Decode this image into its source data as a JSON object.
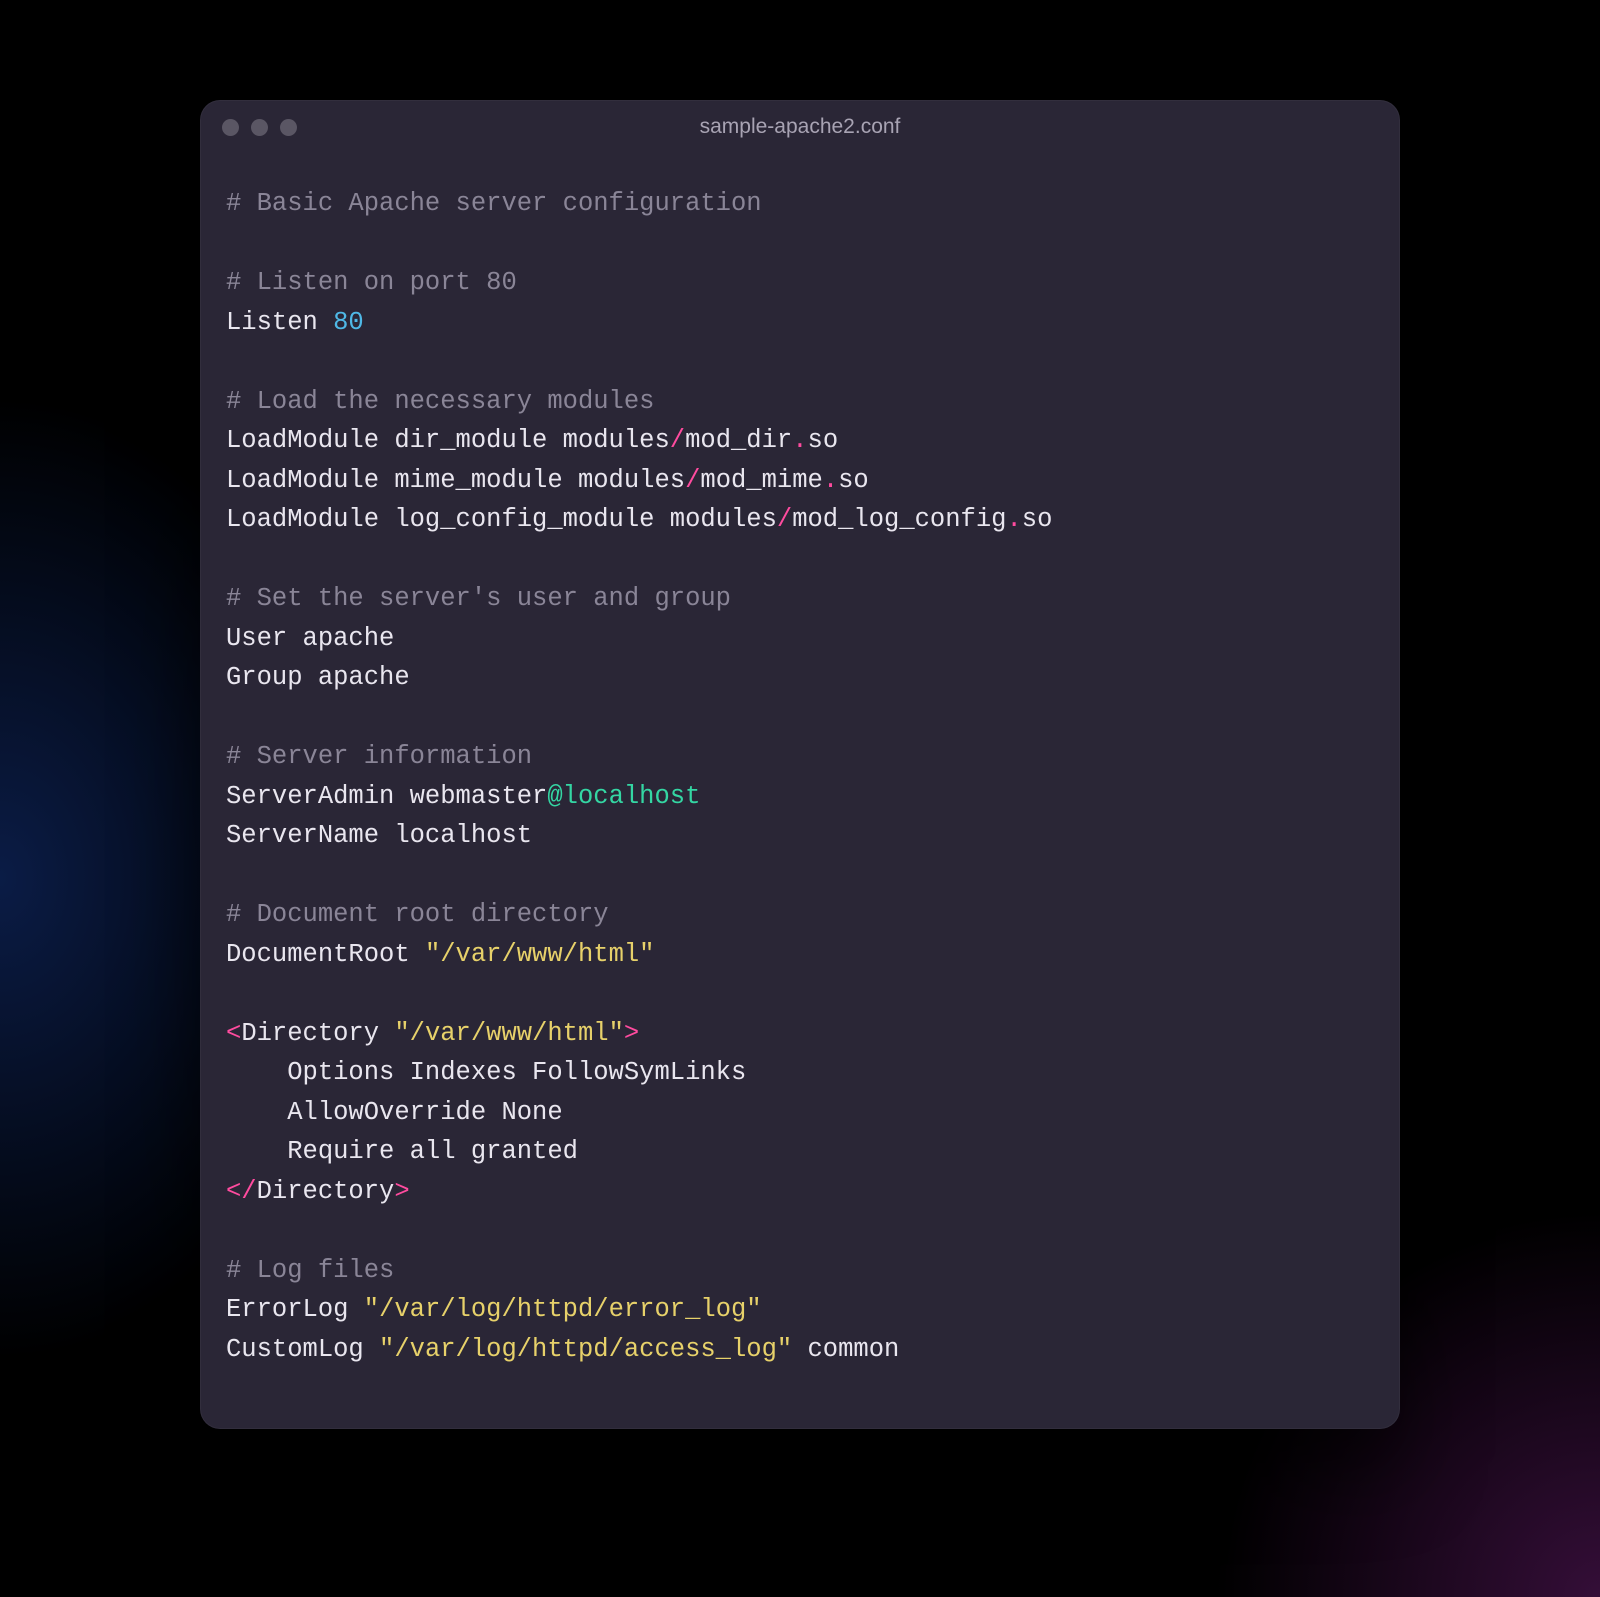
{
  "window": {
    "title": "sample-apache2.conf"
  },
  "code": {
    "lines": [
      [
        {
          "cls": "tok-comment",
          "t": "# Basic Apache server configuration"
        }
      ],
      [
        {
          "cls": "tok-plain",
          "t": ""
        }
      ],
      [
        {
          "cls": "tok-comment",
          "t": "# Listen on port 80"
        }
      ],
      [
        {
          "cls": "tok-plain",
          "t": "Listen "
        },
        {
          "cls": "tok-num",
          "t": "80"
        }
      ],
      [
        {
          "cls": "tok-plain",
          "t": ""
        }
      ],
      [
        {
          "cls": "tok-comment",
          "t": "# Load the necessary modules"
        }
      ],
      [
        {
          "cls": "tok-plain",
          "t": "LoadModule dir_module modules"
        },
        {
          "cls": "tok-punct",
          "t": "/"
        },
        {
          "cls": "tok-plain",
          "t": "mod_dir"
        },
        {
          "cls": "tok-dot",
          "t": "."
        },
        {
          "cls": "tok-ext",
          "t": "so"
        }
      ],
      [
        {
          "cls": "tok-plain",
          "t": "LoadModule mime_module modules"
        },
        {
          "cls": "tok-punct",
          "t": "/"
        },
        {
          "cls": "tok-plain",
          "t": "mod_mime"
        },
        {
          "cls": "tok-dot",
          "t": "."
        },
        {
          "cls": "tok-ext",
          "t": "so"
        }
      ],
      [
        {
          "cls": "tok-plain",
          "t": "LoadModule log_config_module modules"
        },
        {
          "cls": "tok-punct",
          "t": "/"
        },
        {
          "cls": "tok-plain",
          "t": "mod_log_config"
        },
        {
          "cls": "tok-dot",
          "t": "."
        },
        {
          "cls": "tok-ext",
          "t": "so"
        }
      ],
      [
        {
          "cls": "tok-plain",
          "t": ""
        }
      ],
      [
        {
          "cls": "tok-comment",
          "t": "# Set the server's user and group"
        }
      ],
      [
        {
          "cls": "tok-plain",
          "t": "User apache"
        }
      ],
      [
        {
          "cls": "tok-plain",
          "t": "Group apache"
        }
      ],
      [
        {
          "cls": "tok-plain",
          "t": ""
        }
      ],
      [
        {
          "cls": "tok-comment",
          "t": "# Server information"
        }
      ],
      [
        {
          "cls": "tok-plain",
          "t": "ServerAdmin webmaster"
        },
        {
          "cls": "tok-at",
          "t": "@localhost"
        }
      ],
      [
        {
          "cls": "tok-plain",
          "t": "ServerName localhost"
        }
      ],
      [
        {
          "cls": "tok-plain",
          "t": ""
        }
      ],
      [
        {
          "cls": "tok-comment",
          "t": "# Document root directory"
        }
      ],
      [
        {
          "cls": "tok-plain",
          "t": "DocumentRoot "
        },
        {
          "cls": "tok-str",
          "t": "\"/var/www/html\""
        }
      ],
      [
        {
          "cls": "tok-plain",
          "t": ""
        }
      ],
      [
        {
          "cls": "tok-angle",
          "t": "<"
        },
        {
          "cls": "tok-tag",
          "t": "Directory "
        },
        {
          "cls": "tok-str",
          "t": "\"/var/www/html\""
        },
        {
          "cls": "tok-angle",
          "t": ">"
        }
      ],
      [
        {
          "cls": "tok-plain",
          "t": "    Options Indexes FollowSymLinks"
        }
      ],
      [
        {
          "cls": "tok-plain",
          "t": "    AllowOverride None"
        }
      ],
      [
        {
          "cls": "tok-plain",
          "t": "    Require all granted"
        }
      ],
      [
        {
          "cls": "tok-angle",
          "t": "</"
        },
        {
          "cls": "tok-tag",
          "t": "Directory"
        },
        {
          "cls": "tok-angle",
          "t": ">"
        }
      ],
      [
        {
          "cls": "tok-plain",
          "t": ""
        }
      ],
      [
        {
          "cls": "tok-comment",
          "t": "# Log files"
        }
      ],
      [
        {
          "cls": "tok-plain",
          "t": "ErrorLog "
        },
        {
          "cls": "tok-str",
          "t": "\"/var/log/httpd/error_log\""
        }
      ],
      [
        {
          "cls": "tok-plain",
          "t": "CustomLog "
        },
        {
          "cls": "tok-str",
          "t": "\"/var/log/httpd/access_log\""
        },
        {
          "cls": "tok-plain",
          "t": " common"
        }
      ]
    ]
  }
}
